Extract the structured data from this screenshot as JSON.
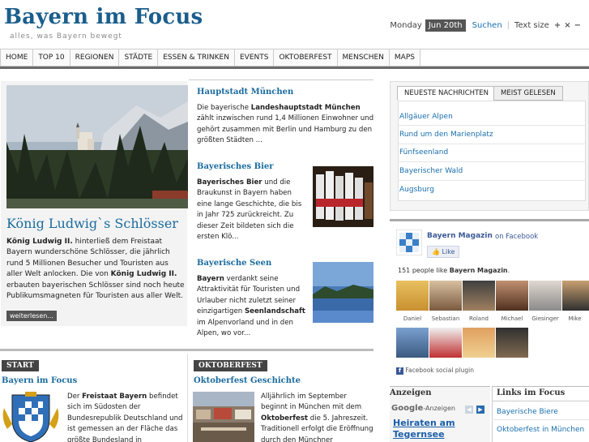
{
  "header": {
    "site_title": "Bayern im Focus",
    "tagline": "alles, was Bayern bewegt",
    "day": "Monday",
    "date": "Jun 20th",
    "search_label": "Suchen",
    "separator": "|",
    "text_size_label": "Text size",
    "text_plus": "+",
    "text_reset": "×",
    "text_minus": "−"
  },
  "nav": {
    "items": [
      "HOME",
      "TOP 10",
      "REGIONEN",
      "STÄDTE",
      "ESSEN & TRINKEN",
      "EVENTS",
      "OKTOBERFEST",
      "MENSCHEN",
      "MAPS"
    ]
  },
  "featured": {
    "title": "König Ludwig`s Schlösser",
    "text_bold1": "König Ludwig II.",
    "text_part1": " hinterließ dem Freistaat Bayern wunderschöne Schlösser, die jährlich rund 5 Millionen Besucher und Touristen aus aller Welt anlocken. Die von ",
    "text_bold2": "König Ludwig II.",
    "text_part2": " erbauten bayerischen Schlösser sind noch heute Publikumsmagneten für Touristen aus aller Welt.",
    "more_label": "weiterlesen..."
  },
  "articles": [
    {
      "title": "Hauptstadt München",
      "pre": "Die bayerische ",
      "bold": "Landeshauptstadt München",
      "post": " zählt inzwischen rund 1,4 Millionen Einwohner und gehört zusammen mit Berlin und Hamburg zu den größten Städten ..."
    },
    {
      "title": "Bayerisches Bier",
      "pre": "",
      "bold": "Bayerisches Bier",
      "post": " und die Braukunst in Bayern haben eine lange Geschichte, die bis in Jahr 725 zurückreicht. Zu dieser Zeit bildeten sich die ersten Klö..."
    },
    {
      "title": "Bayerische Seen",
      "pre": "",
      "bold": "Bayern",
      "post": " verdankt seine Attraktivität für Touristen und Urlauber nicht zuletzt seiner einzigartigen ",
      "bold2": "Seenlandschaft",
      "post2": " im Alpenvorland und in den Alpen, wo vor..."
    }
  ],
  "start_section": {
    "label": "START",
    "title": "Bayern im Focus",
    "pre": "Der ",
    "bold": "Freistaat Bayern",
    "post": " befindet sich im Südosten der Bundesrepublik Deutschland und ist gemessen an der Fläche das größte Bundesland in"
  },
  "oktoberfest_section": {
    "label": "OKTOBERFEST",
    "title": "Oktoberfest Geschichte",
    "pre": "Alljährlich im September beginnt in München mit dem ",
    "bold": "Oktoberfest",
    "post": " die 5. Jahreszeit. Traditionell erfolgt die Eröffnung durch den Münchner Oberbürgermeister im"
  },
  "sidebar_tabs": {
    "tabs": [
      "NEUESTE NACHRICHTEN",
      "MEIST GELESEN"
    ],
    "items": [
      "Allgäuer Alpen",
      "Rund um den Marienplatz",
      "Fünfseenland",
      "Bayerischer Wald",
      "Augsburg"
    ]
  },
  "facebook": {
    "page_name": "Bayern Magazin",
    "on_facebook": "on Facebook",
    "like_label": "Like",
    "count_pre": "151 people like ",
    "count_bold": "Bayern Magazin",
    "count_post": ".",
    "faces": [
      "Daniel",
      "Sebastian",
      "Roland",
      "Michael",
      "Giesinger",
      "Mike"
    ],
    "plugin_label": "Facebook social plugin"
  },
  "ads": {
    "title": "Anzeigen",
    "google_label": "Google",
    "anzeigen_suffix": "-Anzeigen",
    "ad_line1": "Heiraten am",
    "ad_line2": "Tegernsee"
  },
  "links": {
    "title": "Links im Focus",
    "items": [
      "Bayerische Biere",
      "Oktoberfest in München"
    ]
  },
  "colors": {
    "brand": "#1a5e8c",
    "link": "#1a6fae",
    "dark_label": "#444444"
  }
}
